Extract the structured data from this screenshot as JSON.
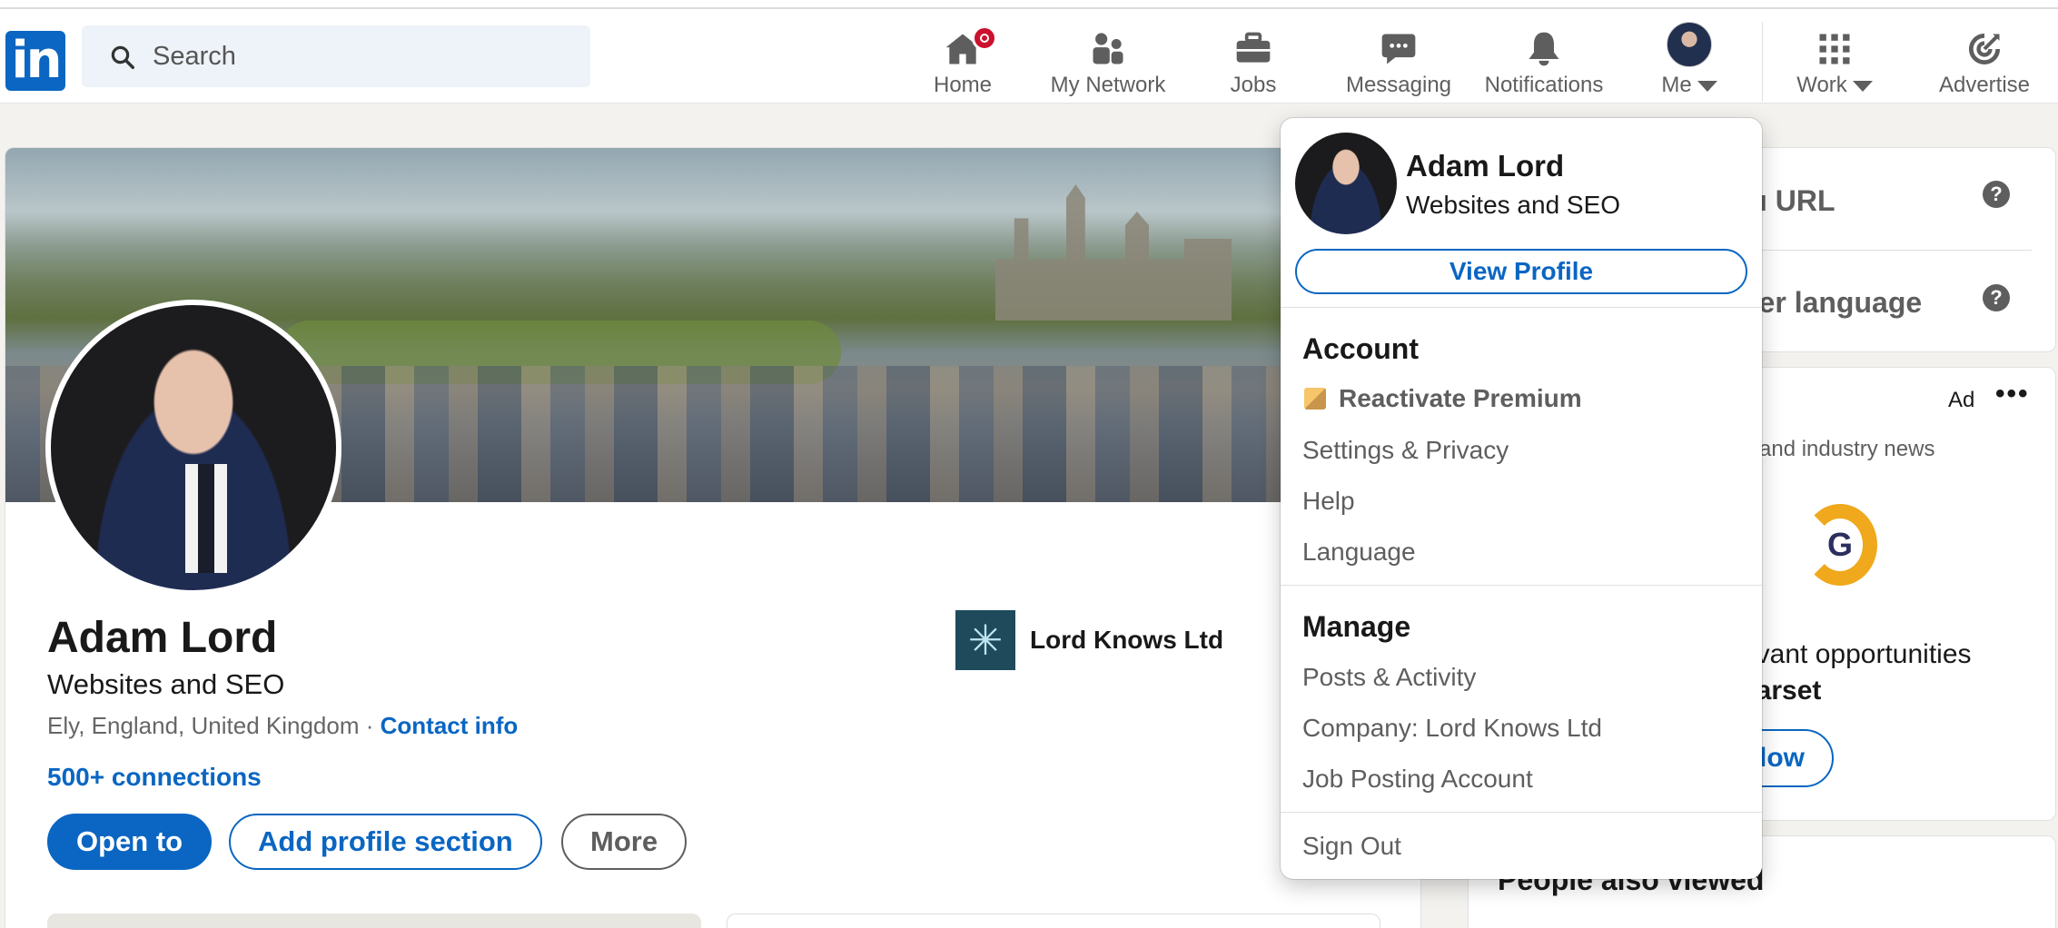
{
  "search": {
    "placeholder": "Search"
  },
  "nav": [
    {
      "label": "Home"
    },
    {
      "label": "My Network"
    },
    {
      "label": "Jobs"
    },
    {
      "label": "Messaging"
    },
    {
      "label": "Notifications"
    },
    {
      "label": "Me"
    },
    {
      "label": "Work"
    },
    {
      "label": "Advertise"
    }
  ],
  "profile": {
    "name": "Adam Lord",
    "headline": "Websites and SEO",
    "location": "Ely, England, United Kingdom",
    "separator": "·",
    "contact_info": "Contact info",
    "connections": "500+ connections",
    "company": "Lord Knows Ltd",
    "buttons": {
      "open_to": "Open to",
      "add_section": "Add profile section",
      "more": "More"
    }
  },
  "right": {
    "url_fragment": "ı URL",
    "language_fragment": "her language",
    "ad_label": "Ad",
    "ad_news": "and industry news",
    "ad_line1": "evant opportunities",
    "ad_line2": "earset",
    "ad_follow": "low",
    "people_also_viewed": "People also viewed"
  },
  "dropdown": {
    "name": "Adam Lord",
    "headline": "Websites and SEO",
    "view_profile": "View Profile",
    "account_title": "Account",
    "reactivate_premium": "Reactivate Premium",
    "settings_privacy": "Settings & Privacy",
    "help": "Help",
    "language": "Language",
    "manage_title": "Manage",
    "posts_activity": "Posts & Activity",
    "company": "Company: Lord Knows Ltd",
    "job_posting": "Job Posting Account",
    "sign_out": "Sign Out"
  },
  "colors": {
    "brand": "#0a66c2",
    "badge": "#cb112d",
    "premium": "#e7a33e"
  }
}
